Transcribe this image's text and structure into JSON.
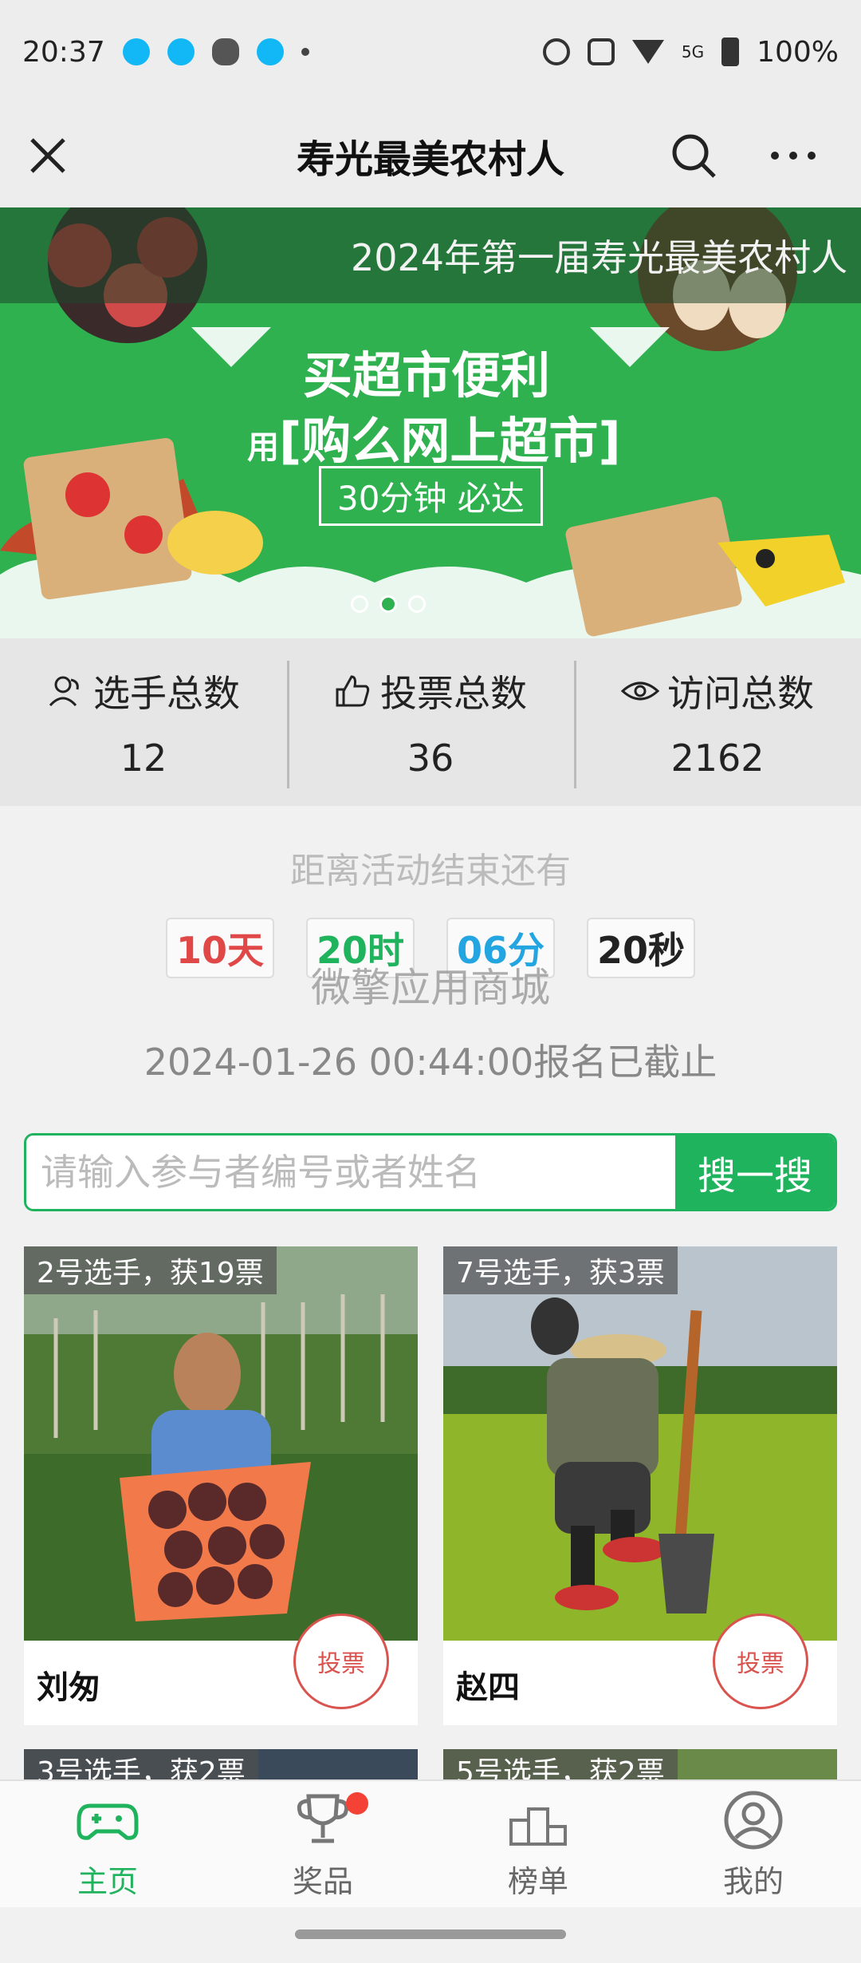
{
  "status_bar": {
    "time": "20:37",
    "network": "5G",
    "battery": "100%"
  },
  "title_bar": {
    "title": "寿光最美农村人"
  },
  "banner": {
    "marquee": "2024年第一届寿光最美农村人",
    "headline": "买超市便利",
    "sub_prefix": "用",
    "sub": "[购么网上超市]",
    "box": "30分钟 必达",
    "slide_count": 3,
    "active_slide": 2
  },
  "stats": [
    {
      "label": "选手总数",
      "value": "12",
      "icon": "users-icon"
    },
    {
      "label": "投票总数",
      "value": "36",
      "icon": "thumbs-up-icon"
    },
    {
      "label": "访问总数",
      "value": "2162",
      "icon": "eye-icon"
    }
  ],
  "countdown": {
    "title": "距离活动结束还有",
    "days": "10天",
    "hours": "20时",
    "minutes": "06分",
    "seconds": "20秒",
    "watermark": "微擎应用商城",
    "deadline": "2024-01-26 00:44:00报名已截止"
  },
  "search": {
    "placeholder": "请输入参与者编号或者姓名",
    "button": "搜一搜"
  },
  "contestants": [
    {
      "badge": "2号选手，获19票",
      "name": "刘匆",
      "vote": "投票"
    },
    {
      "badge": "7号选手，获3票",
      "name": "赵四",
      "vote": "投票"
    },
    {
      "badge": "3号选手，获2票"
    },
    {
      "badge": "5号选手，获2票"
    }
  ],
  "bottom_nav": [
    {
      "label": "主页",
      "icon": "gamepad-icon",
      "active": true
    },
    {
      "label": "奖品",
      "icon": "trophy-icon",
      "badge": true
    },
    {
      "label": "榜单",
      "icon": "podium-icon"
    },
    {
      "label": "我的",
      "icon": "user-icon"
    }
  ],
  "colors": {
    "brand_green": "#20b35d",
    "days": "#e04848",
    "hours": "#20b35d",
    "minutes": "#22a5e0",
    "seconds": "#222222"
  }
}
